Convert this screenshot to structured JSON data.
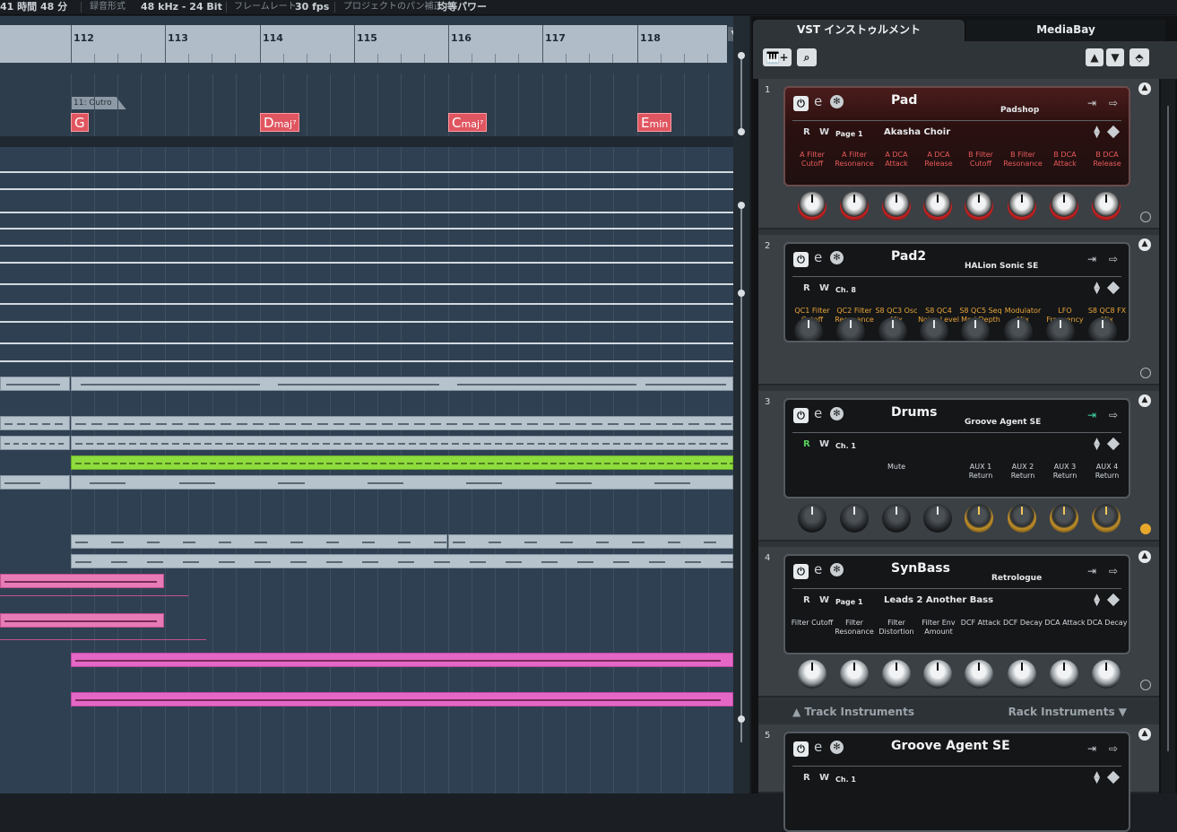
{
  "statusbar": {
    "rec_time": "41 時間 48 分",
    "rec_format_label": "録音形式",
    "rec_format": "48 kHz - 24 Bit",
    "frame_rate_label": "フレームレート",
    "frame_rate": "30 fps",
    "pan_law_label": "プロジェクトのパン補正",
    "pan_law": "均等パワー"
  },
  "ruler": {
    "bars": [
      "112",
      "113",
      "114",
      "115",
      "116",
      "117",
      "118"
    ]
  },
  "markers": {
    "section": "11: Outro",
    "chords": [
      {
        "root": "G",
        "suffix": ""
      },
      {
        "root": "D",
        "suffix": "maj⁷"
      },
      {
        "root": "C",
        "suffix": "maj⁷"
      },
      {
        "root": "E",
        "suffix": "min"
      }
    ]
  },
  "rack": {
    "tabs": [
      "VST インストゥルメント",
      "MediaBay"
    ],
    "toolbar": {
      "add": "🎹+",
      "search": "⌕",
      "up": "▲",
      "down": "▼",
      "menu": "⬘"
    },
    "switch_track": "▲ Track Instruments",
    "switch_rack": "Rack Instruments ▼",
    "instruments": [
      {
        "num": "1",
        "name": "Pad",
        "plugin": "Padshop",
        "page": "Page 1",
        "preset": "Akasha Choir",
        "params": [
          "A Filter Cutoff",
          "A Filter Resonance",
          "A DCA Attack",
          "A DCA Release",
          "B Filter Cutoff",
          "B Filter Resonance",
          "B DCA Attack",
          "B DCA Release"
        ]
      },
      {
        "num": "2",
        "name": "Pad2",
        "plugin": "HALion Sonic SE",
        "page": "Ch. 8",
        "preset": "",
        "params": [
          "QC1 Filter Cutoff",
          "QC2 Filter Resonance",
          "S8 QC3 Osc Mix",
          "S8 QC4 Noise Level",
          "S8 QC5 Seq Mod Depth",
          "Modulator Mix",
          "LFO Frequency",
          "S8 QC8 FX Mix"
        ]
      },
      {
        "num": "3",
        "name": "Drums",
        "plugin": "Groove Agent SE",
        "page": "Ch. 1",
        "preset": "",
        "params": [
          "",
          "",
          "Mute",
          "",
          "AUX 1 Return",
          "AUX 2 Return",
          "AUX 3 Return",
          "AUX 4 Return"
        ]
      },
      {
        "num": "4",
        "name": "SynBass",
        "plugin": "Retrologue",
        "page": "Page 1",
        "preset": "Leads 2 Another Bass",
        "params": [
          "Filter Cutoff",
          "Filter Resonance",
          "Filter Distortion",
          "Filter Env Amount",
          "DCF Attack",
          "DCF Decay",
          "DCA Attack",
          "DCA Decay"
        ]
      },
      {
        "num": "5",
        "name": "Groove Agent SE",
        "plugin": "",
        "page": "Ch. 1",
        "preset": "",
        "params": []
      }
    ]
  },
  "colors": {
    "chord_marker": "#e05660",
    "green_part": "#8edc3e",
    "pink_part": "#e77bb6",
    "knob_gold": "#c49128"
  }
}
